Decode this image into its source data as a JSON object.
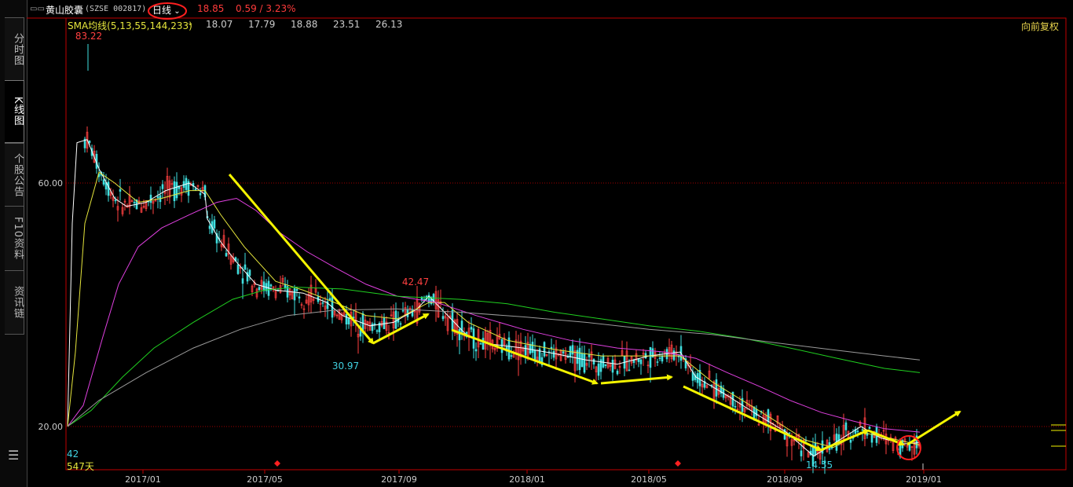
{
  "sidebar": {
    "tabs": [
      {
        "label": "分时图",
        "active": false
      },
      {
        "label": "K线图",
        "active": true
      },
      {
        "label": "个股公告",
        "active": false
      },
      {
        "label": "F10资料",
        "active": false
      },
      {
        "label": "资讯链",
        "active": false
      }
    ],
    "menu_icon": "menu-icon"
  },
  "header": {
    "window_icon": "window-icon",
    "stock_name": "黄山胶囊",
    "stock_code": "(SZSE 002817)",
    "period": "日线",
    "price": "18.85",
    "change": "0.59 / 3.23%",
    "fq_label": "向前复权",
    "colors": {
      "up": "#ff3b3b",
      "period_circle": "#ff2020"
    }
  },
  "ma_bar": {
    "label": "SMA均线(5,13,55,144,233)",
    "values": [
      {
        "value": "18.07",
        "color": "#ffffff"
      },
      {
        "value": "17.79",
        "color": "#e6e63c"
      },
      {
        "value": "18.88",
        "color": "#e040e0"
      },
      {
        "value": "23.51",
        "color": "#20d020"
      },
      {
        "value": "26.13",
        "color": "#9a9a9a"
      }
    ]
  },
  "footer": {
    "volume_value": "42",
    "days_label": "547天"
  },
  "chart_data": {
    "type": "line",
    "y_scale": "log",
    "ylim": [
      17.5,
      88
    ],
    "y_ticks": [
      {
        "value": 60,
        "label": "60.00"
      },
      {
        "value": 20,
        "label": "20.00"
      }
    ],
    "x_ticks": [
      "2017/01",
      "2017/05",
      "2017/09",
      "2018/01",
      "2018/05",
      "2018/09",
      "2019/01"
    ],
    "annotations": [
      {
        "label": "83.22",
        "date": "2016-11",
        "value": 83.22,
        "kind": "high",
        "color": "#ff4040"
      },
      {
        "label": "42.47",
        "date": "2017-08",
        "value": 42.47,
        "kind": "high",
        "color": "#ff4040"
      },
      {
        "label": "30.97",
        "date": "2017-07",
        "value": 30.97,
        "kind": "low",
        "color": "#40d0e0"
      },
      {
        "label": "14.55",
        "date": "2018-10",
        "value": 14.55,
        "kind": "low",
        "color": "#40d0e0"
      }
    ],
    "series": [
      {
        "name": "SMA5",
        "color": "#ffffff",
        "points": [
          [
            0,
            20
          ],
          [
            6,
            50
          ],
          [
            12,
            72
          ],
          [
            25,
            73
          ],
          [
            40,
            64
          ],
          [
            60,
            56
          ],
          [
            75,
            54
          ],
          [
            100,
            55
          ],
          [
            125,
            58
          ],
          [
            155,
            60
          ],
          [
            175,
            57
          ],
          [
            178,
            51
          ],
          [
            195,
            46
          ],
          [
            215,
            42
          ],
          [
            240,
            38
          ],
          [
            265,
            37
          ],
          [
            300,
            36.5
          ],
          [
            330,
            35
          ],
          [
            350,
            33
          ],
          [
            385,
            31.5
          ],
          [
            415,
            32
          ],
          [
            445,
            34
          ],
          [
            460,
            36
          ],
          [
            480,
            33.5
          ],
          [
            510,
            30
          ],
          [
            540,
            29
          ],
          [
            580,
            28.5
          ],
          [
            620,
            27.8
          ],
          [
            660,
            27
          ],
          [
            700,
            26.5
          ],
          [
            740,
            27.5
          ],
          [
            780,
            28
          ],
          [
            800,
            25
          ],
          [
            840,
            23
          ],
          [
            880,
            21
          ],
          [
            915,
            19.5
          ],
          [
            950,
            17.5
          ],
          [
            975,
            18.5
          ],
          [
            1010,
            20
          ],
          [
            1035,
            19
          ],
          [
            1065,
            18.5
          ],
          [
            1085,
            18.6
          ]
        ]
      },
      {
        "name": "SMA13",
        "color": "#e6e63c",
        "points": [
          [
            0,
            20
          ],
          [
            10,
            28
          ],
          [
            22,
            50
          ],
          [
            40,
            63
          ],
          [
            60,
            60
          ],
          [
            90,
            55
          ],
          [
            120,
            56
          ],
          [
            155,
            58
          ],
          [
            175,
            58
          ],
          [
            195,
            52
          ],
          [
            225,
            45
          ],
          [
            265,
            38.5
          ],
          [
            300,
            37
          ],
          [
            340,
            35
          ],
          [
            380,
            33
          ],
          [
            420,
            32.5
          ],
          [
            460,
            35
          ],
          [
            480,
            35
          ],
          [
            510,
            32
          ],
          [
            560,
            29.5
          ],
          [
            620,
            28.3
          ],
          [
            680,
            27.5
          ],
          [
            740,
            27.5
          ],
          [
            780,
            27.5
          ],
          [
            820,
            24.5
          ],
          [
            880,
            21.5
          ],
          [
            940,
            18.8
          ],
          [
            975,
            18.2
          ],
          [
            1010,
            19.5
          ],
          [
            1045,
            19
          ],
          [
            1085,
            18.4
          ]
        ]
      },
      {
        "name": "SMA55",
        "color": "#e040e0",
        "points": [
          [
            0,
            20
          ],
          [
            20,
            22
          ],
          [
            45,
            30
          ],
          [
            65,
            38
          ],
          [
            90,
            45
          ],
          [
            120,
            49
          ],
          [
            155,
            52
          ],
          [
            190,
            55
          ],
          [
            215,
            56
          ],
          [
            240,
            53
          ],
          [
            270,
            48
          ],
          [
            305,
            44
          ],
          [
            340,
            41
          ],
          [
            380,
            38
          ],
          [
            420,
            36
          ],
          [
            470,
            35
          ],
          [
            520,
            33
          ],
          [
            580,
            31
          ],
          [
            640,
            29.5
          ],
          [
            700,
            28.5
          ],
          [
            760,
            28
          ],
          [
            800,
            27.2
          ],
          [
            840,
            25.5
          ],
          [
            880,
            24
          ],
          [
            920,
            22.5
          ],
          [
            960,
            21.3
          ],
          [
            1000,
            20.5
          ],
          [
            1040,
            19.8
          ],
          [
            1085,
            19.5
          ]
        ]
      },
      {
        "name": "SMA144",
        "color": "#20d020",
        "points": [
          [
            0,
            20
          ],
          [
            30,
            21.5
          ],
          [
            70,
            25
          ],
          [
            110,
            28.5
          ],
          [
            160,
            32
          ],
          [
            210,
            35.5
          ],
          [
            250,
            37
          ],
          [
            290,
            37.5
          ],
          [
            350,
            37.2
          ],
          [
            420,
            36
          ],
          [
            500,
            35.5
          ],
          [
            560,
            34.8
          ],
          [
            620,
            33.5
          ],
          [
            680,
            32.5
          ],
          [
            740,
            31.5
          ],
          [
            800,
            30.8
          ],
          [
            860,
            29.8
          ],
          [
            920,
            28.5
          ],
          [
            980,
            27.2
          ],
          [
            1040,
            26
          ],
          [
            1085,
            25.5
          ]
        ]
      },
      {
        "name": "SMA233",
        "color": "#9a9a9a",
        "points": [
          [
            0,
            20
          ],
          [
            40,
            22.5
          ],
          [
            100,
            25.5
          ],
          [
            160,
            28.5
          ],
          [
            220,
            31
          ],
          [
            280,
            33
          ],
          [
            340,
            33.8
          ],
          [
            420,
            34
          ],
          [
            500,
            33.5
          ],
          [
            580,
            32.8
          ],
          [
            660,
            32
          ],
          [
            740,
            31
          ],
          [
            820,
            30.3
          ],
          [
            900,
            29.2
          ],
          [
            980,
            28.2
          ],
          [
            1040,
            27.5
          ],
          [
            1085,
            27
          ]
        ]
      }
    ]
  }
}
